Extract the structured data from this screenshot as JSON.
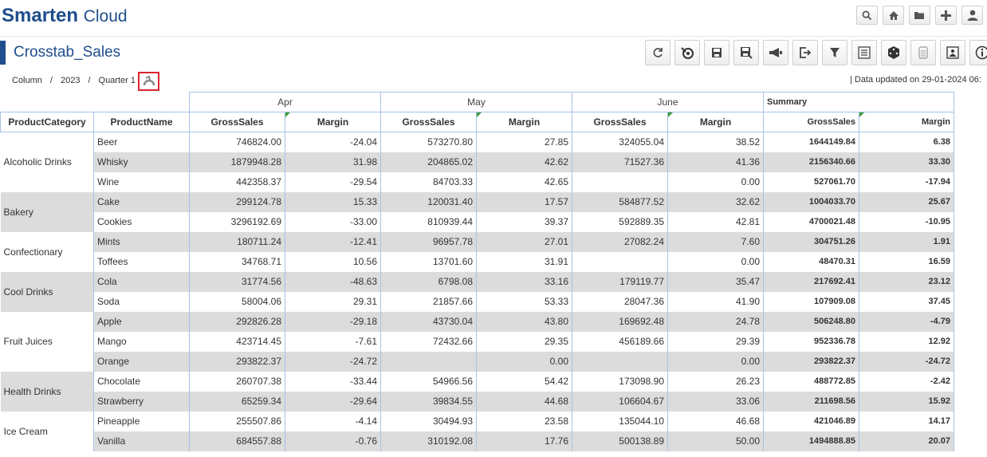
{
  "brand": {
    "name": "Smarten",
    "suffix": "Cloud"
  },
  "page_title": "Crosstab_Sales",
  "breadcrumb": {
    "level1": "Column",
    "level2": "2023",
    "level3": "Quarter 1"
  },
  "data_updated": "|  Data updated on 29-01-2024 06:",
  "top_icons": [
    "search-icon",
    "home-icon",
    "folder-icon",
    "plus-icon",
    "user-icon"
  ],
  "toolbar_icons": [
    "refresh-icon",
    "reset-icon",
    "save-icon",
    "save-as-icon",
    "announce-icon",
    "export-icon",
    "filter-icon",
    "list-icon",
    "cube-icon",
    "data-icon",
    "image-icon",
    "info-icon"
  ],
  "table": {
    "months": [
      "Apr",
      "May",
      "June"
    ],
    "summary_label": "Summary",
    "headers": {
      "category": "ProductCategory",
      "product": "ProductName",
      "gross": "GrossSales",
      "margin": "Margin"
    },
    "groups": [
      {
        "category": "Alcoholic Drinks",
        "rows": [
          {
            "product": "Beer",
            "apr_gs": "746824.00",
            "apr_m": "-24.04",
            "may_gs": "573270.80",
            "may_m": "27.85",
            "jun_gs": "324055.04",
            "jun_m": "38.52",
            "sum_gs": "1644149.84",
            "sum_m": "6.38"
          },
          {
            "product": "Whisky",
            "apr_gs": "1879948.28",
            "apr_m": "31.98",
            "may_gs": "204865.02",
            "may_m": "42.62",
            "jun_gs": "71527.36",
            "jun_m": "41.36",
            "sum_gs": "2156340.66",
            "sum_m": "33.30"
          },
          {
            "product": "Wine",
            "apr_gs": "442358.37",
            "apr_m": "-29.54",
            "may_gs": "84703.33",
            "may_m": "42.65",
            "jun_gs": "",
            "jun_m": "0.00",
            "sum_gs": "527061.70",
            "sum_m": "-17.94"
          }
        ]
      },
      {
        "category": "Bakery",
        "rows": [
          {
            "product": "Cake",
            "apr_gs": "299124.78",
            "apr_m": "15.33",
            "may_gs": "120031.40",
            "may_m": "17.57",
            "jun_gs": "584877.52",
            "jun_m": "32.62",
            "sum_gs": "1004033.70",
            "sum_m": "25.67"
          },
          {
            "product": "Cookies",
            "apr_gs": "3296192.69",
            "apr_m": "-33.00",
            "may_gs": "810939.44",
            "may_m": "39.37",
            "jun_gs": "592889.35",
            "jun_m": "42.81",
            "sum_gs": "4700021.48",
            "sum_m": "-10.95"
          }
        ]
      },
      {
        "category": "Confectionary",
        "rows": [
          {
            "product": "Mints",
            "apr_gs": "180711.24",
            "apr_m": "-12.41",
            "may_gs": "96957.78",
            "may_m": "27.01",
            "jun_gs": "27082.24",
            "jun_m": "7.60",
            "sum_gs": "304751.26",
            "sum_m": "1.91"
          },
          {
            "product": "Toffees",
            "apr_gs": "34768.71",
            "apr_m": "10.56",
            "may_gs": "13701.60",
            "may_m": "31.91",
            "jun_gs": "",
            "jun_m": "0.00",
            "sum_gs": "48470.31",
            "sum_m": "16.59"
          }
        ]
      },
      {
        "category": "Cool Drinks",
        "rows": [
          {
            "product": "Cola",
            "apr_gs": "31774.56",
            "apr_m": "-48.63",
            "may_gs": "6798.08",
            "may_m": "33.16",
            "jun_gs": "179119.77",
            "jun_m": "35.47",
            "sum_gs": "217692.41",
            "sum_m": "23.12"
          },
          {
            "product": "Soda",
            "apr_gs": "58004.06",
            "apr_m": "29.31",
            "may_gs": "21857.66",
            "may_m": "53.33",
            "jun_gs": "28047.36",
            "jun_m": "41.90",
            "sum_gs": "107909.08",
            "sum_m": "37.45"
          }
        ]
      },
      {
        "category": "Fruit Juices",
        "rows": [
          {
            "product": "Apple",
            "apr_gs": "292826.28",
            "apr_m": "-29.18",
            "may_gs": "43730.04",
            "may_m": "43.80",
            "jun_gs": "169692.48",
            "jun_m": "24.78",
            "sum_gs": "506248.80",
            "sum_m": "-4.79"
          },
          {
            "product": "Mango",
            "apr_gs": "423714.45",
            "apr_m": "-7.61",
            "may_gs": "72432.66",
            "may_m": "29.35",
            "jun_gs": "456189.66",
            "jun_m": "29.39",
            "sum_gs": "952336.78",
            "sum_m": "12.92"
          },
          {
            "product": "Orange",
            "apr_gs": "293822.37",
            "apr_m": "-24.72",
            "may_gs": "",
            "may_m": "0.00",
            "jun_gs": "",
            "jun_m": "0.00",
            "sum_gs": "293822.37",
            "sum_m": "-24.72"
          }
        ]
      },
      {
        "category": "Health Drinks",
        "rows": [
          {
            "product": "Chocolate",
            "apr_gs": "260707.38",
            "apr_m": "-33.44",
            "may_gs": "54966.56",
            "may_m": "54.42",
            "jun_gs": "173098.90",
            "jun_m": "26.23",
            "sum_gs": "488772.85",
            "sum_m": "-2.42"
          },
          {
            "product": "Strawberry",
            "apr_gs": "65259.34",
            "apr_m": "-29.64",
            "may_gs": "39834.55",
            "may_m": "44.68",
            "jun_gs": "106604.67",
            "jun_m": "33.06",
            "sum_gs": "211698.56",
            "sum_m": "15.92"
          }
        ]
      },
      {
        "category": "Ice Cream",
        "rows": [
          {
            "product": "Pineapple",
            "apr_gs": "255507.86",
            "apr_m": "-4.14",
            "may_gs": "30494.93",
            "may_m": "23.58",
            "jun_gs": "135044.10",
            "jun_m": "46.68",
            "sum_gs": "421046.89",
            "sum_m": "14.17"
          },
          {
            "product": "Vanilla",
            "apr_gs": "684557.88",
            "apr_m": "-0.76",
            "may_gs": "310192.08",
            "may_m": "17.76",
            "jun_gs": "500138.89",
            "jun_m": "50.00",
            "sum_gs": "1494888.85",
            "sum_m": "20.07"
          }
        ]
      }
    ]
  }
}
